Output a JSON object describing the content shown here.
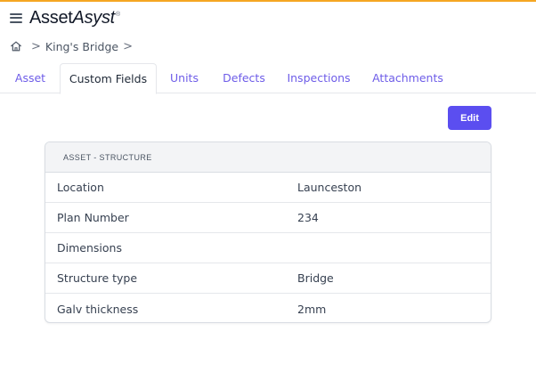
{
  "app": {
    "logo_part1": "Asset",
    "logo_part2": "Asyst",
    "logo_mark": "®",
    "accent_color": "#5b4ef0",
    "top_bar_color": "#f5a623"
  },
  "breadcrumb": {
    "home_icon": "home-icon",
    "separator": ">",
    "items": [
      "King's Bridge"
    ]
  },
  "tabs": [
    {
      "label": "Asset",
      "active": false
    },
    {
      "label": "Custom Fields",
      "active": true
    },
    {
      "label": "Units",
      "active": false
    },
    {
      "label": "Defects",
      "active": false
    },
    {
      "label": "Inspections",
      "active": false
    },
    {
      "label": "Attachments",
      "active": false
    }
  ],
  "toolbar": {
    "edit_label": "Edit"
  },
  "custom_fields": {
    "section_title": "ASSET - STRUCTURE",
    "rows": [
      {
        "label": "Location",
        "value": "Launceston"
      },
      {
        "label": "Plan Number",
        "value": "234"
      },
      {
        "label": "Dimensions",
        "value": ""
      },
      {
        "label": "Structure type",
        "value": "Bridge"
      },
      {
        "label": "Galv thickness",
        "value": "2mm"
      }
    ]
  }
}
